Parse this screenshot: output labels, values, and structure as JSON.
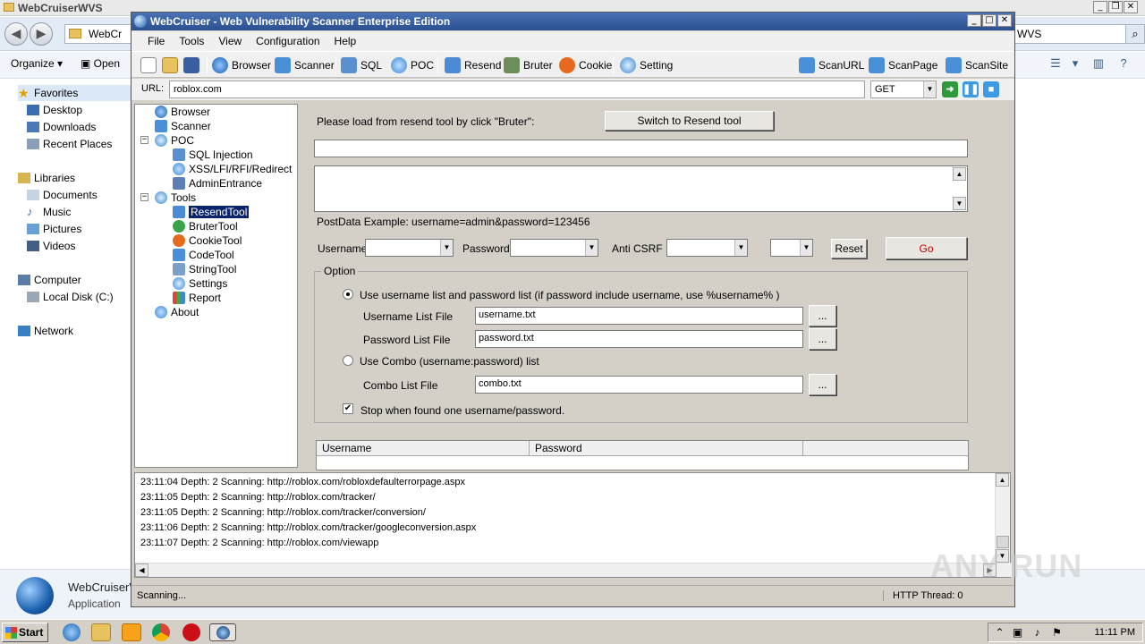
{
  "explorer": {
    "title": "WebCruiserWVS",
    "address": "WebCr",
    "search_value": "WVS",
    "toolbar": {
      "organize": "Organize",
      "open": "Open"
    },
    "nav": {
      "favorites": "Favorites",
      "desktop": "Desktop",
      "downloads": "Downloads",
      "recent": "Recent Places",
      "libraries": "Libraries",
      "documents": "Documents",
      "music": "Music",
      "pictures": "Pictures",
      "videos": "Videos",
      "computer": "Computer",
      "localdisk": "Local Disk (C:)",
      "network": "Network"
    },
    "details": {
      "name": "WebCruiserV",
      "type": "Application"
    }
  },
  "wc": {
    "title": "WebCruiser - Web Vulnerability Scanner Enterprise Edition",
    "menu": [
      "File",
      "Tools",
      "View",
      "Configuration",
      "Help"
    ],
    "toolbar": {
      "browser": "Browser",
      "scanner": "Scanner",
      "sql": "SQL",
      "poc": "POC",
      "resend": "Resend",
      "bruter": "Bruter",
      "cookie": "Cookie",
      "setting": "Setting",
      "scanurl": "ScanURL",
      "scanpage": "ScanPage",
      "scansite": "ScanSite"
    },
    "url_label": "URL:",
    "url_value": "roblox.com",
    "method": "GET",
    "tree": {
      "browser": "Browser",
      "scanner": "Scanner",
      "poc": "POC",
      "sqlinjection": "SQL Injection",
      "xss": "XSS/LFI/RFI/Redirect",
      "adminentrance": "AdminEntrance",
      "tools": "Tools",
      "resendtool": "ResendTool",
      "brutertool": "BruterTool",
      "cookietool": "CookieTool",
      "codetool": "CodeTool",
      "stringtool": "StringTool",
      "settings": "Settings",
      "report": "Report",
      "about": "About"
    },
    "main": {
      "load_hint": "Please load from resend tool by click \"Bruter\":",
      "switch_button": "Switch to Resend tool",
      "postdata_example": "PostData Example: username=admin&password=123456",
      "username_label": "Username",
      "password_label": "Password",
      "anticsrf_label": "Anti CSRF",
      "reset_button": "Reset",
      "go_button": "Go",
      "option_label": "Option",
      "radio_list": "Use username list and password list (if password include username, use %username% )",
      "userlist_label": "Username List File",
      "userlist_value": "username.txt",
      "passlist_label": "Password List File",
      "passlist_value": "password.txt",
      "radio_combo": "Use Combo (username:password) list",
      "combo_label": "Combo List File",
      "combo_value": "combo.txt",
      "browse": "...",
      "stop_check": "Stop when found one username/password.",
      "col_username": "Username",
      "col_password": "Password"
    },
    "log": [
      "23:11:04 Depth: 2  Scanning: http://roblox.com/robloxdefaulterrorpage.aspx",
      "23:11:05 Depth: 2  Scanning: http://roblox.com/tracker/",
      "23:11:05 Depth: 2  Scanning: http://roblox.com/tracker/conversion/",
      "23:11:06 Depth: 2  Scanning: http://roblox.com/tracker/googleconversion.aspx",
      "23:11:07 Depth: 2  Scanning: http://roblox.com/viewapp"
    ],
    "status_left": "Scanning...",
    "status_right": "HTTP Thread: 0"
  },
  "taskbar": {
    "start": "Start",
    "clock": "11:11 PM"
  },
  "watermark": "ANY RUN"
}
